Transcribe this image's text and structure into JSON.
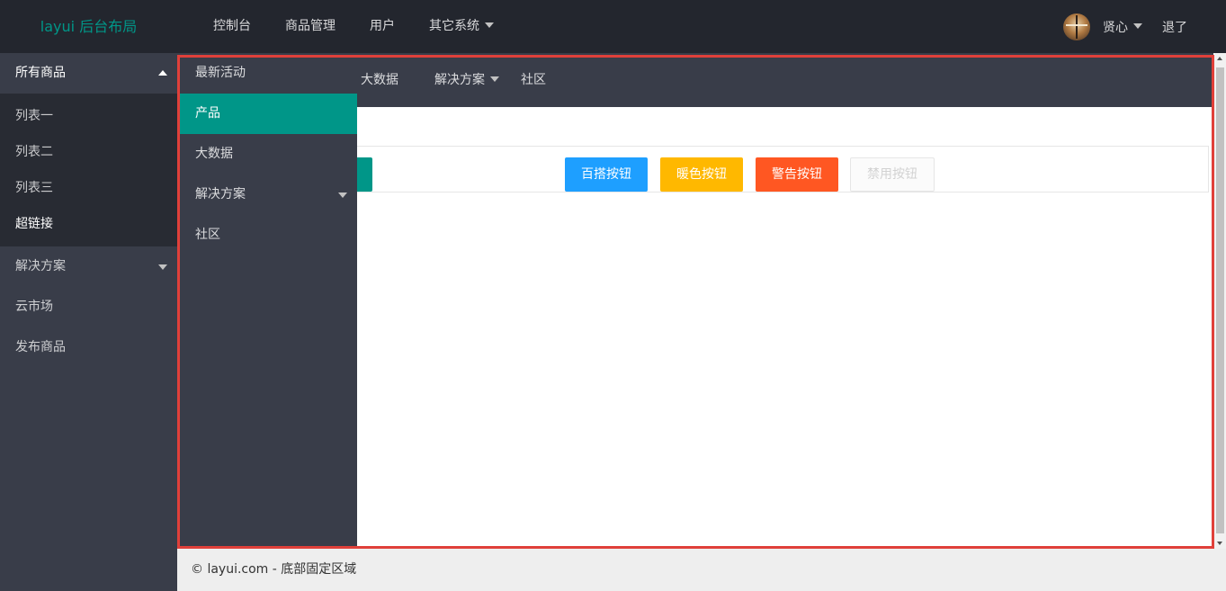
{
  "header": {
    "logo": "layui 后台布局",
    "nav": [
      "控制台",
      "商品管理",
      "用户",
      "其它系统"
    ],
    "user_name": "贤心",
    "logout": "退了"
  },
  "sidebar": {
    "group_title": "所有商品",
    "sub_items": [
      "列表一",
      "列表二",
      "列表三",
      "超链接"
    ],
    "items": [
      "解决方案",
      "云市场",
      "发布商品"
    ]
  },
  "inner_nav": {
    "items": [
      "大数据",
      "解决方案",
      "社区"
    ]
  },
  "dropdown": {
    "items": [
      "最新活动",
      "产品",
      "大数据",
      "解决方案",
      "社区"
    ],
    "active": "产品"
  },
  "buttons": {
    "blue": "百搭按钮",
    "warm": "暖色按钮",
    "danger": "警告按钮",
    "disabled": "禁用按钮"
  },
  "footer": {
    "text": "© layui.com - 底部固定区域"
  },
  "colors": {
    "accent": "#009688",
    "header_bg": "#23262e",
    "highlight": "#e0403a"
  }
}
